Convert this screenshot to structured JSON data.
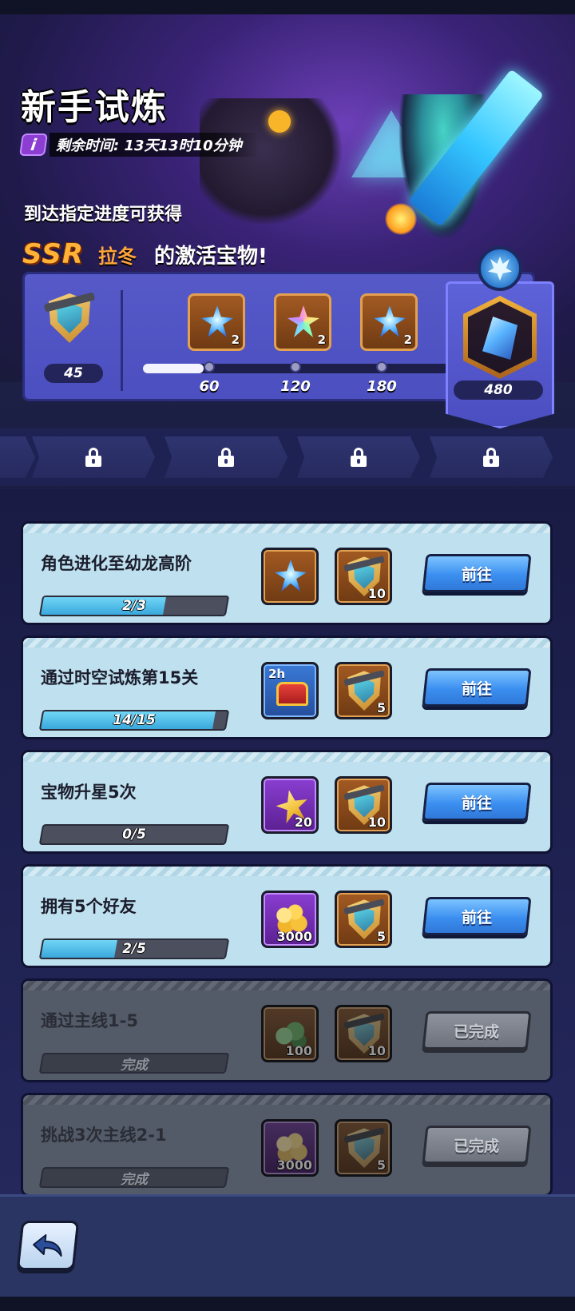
{
  "header": {
    "title": "新手试炼",
    "info_icon": "i",
    "timer_text": "剩余时间: 13天13时10分钟",
    "progress_hint": "到达指定进度可获得",
    "reward_rarity": "SSR",
    "reward_hero": "拉冬",
    "reward_suffix": "的激活宝物!"
  },
  "progress": {
    "current_points": "45",
    "milestones": [
      {
        "points": "60",
        "reward_icon": "blue-star-crystal-icon",
        "count": "2"
      },
      {
        "points": "120",
        "reward_icon": "rainbow-star-crystal-icon",
        "count": "2"
      },
      {
        "points": "180",
        "reward_icon": "blue-star-crystal-icon",
        "count": "2"
      }
    ],
    "final": {
      "points": "480",
      "reward_icon": "frost-gauntlet-icon"
    },
    "track_fill_fraction": 0.18
  },
  "tabs": [
    {
      "locked": true,
      "icon": "lock-icon"
    },
    {
      "locked": true,
      "icon": "lock-icon"
    },
    {
      "locked": true,
      "icon": "lock-icon"
    },
    {
      "locked": true,
      "icon": "lock-icon"
    }
  ],
  "tasks": [
    {
      "title": "角色进化至幼龙高阶",
      "progress_text": "2/3",
      "progress_fraction": 0.6667,
      "rewards": [
        {
          "icon": "blue-star-crystal-icon",
          "count": ""
        },
        {
          "icon": "trial-shield-icon",
          "count": "10"
        }
      ],
      "button": "前往",
      "completed": false
    },
    {
      "title": "通过时空试炼第15关",
      "progress_text": "14/15",
      "progress_fraction": 0.9333,
      "rewards": [
        {
          "icon": "treasure-chest-icon",
          "label": "2h",
          "count": ""
        },
        {
          "icon": "trial-shield-icon",
          "count": "5"
        }
      ],
      "button": "前往",
      "completed": false
    },
    {
      "title": "宝物升星5次",
      "progress_text": "0/5",
      "progress_fraction": 0,
      "rewards": [
        {
          "icon": "gold-star-icon",
          "count": "20"
        },
        {
          "icon": "trial-shield-icon",
          "count": "10"
        }
      ],
      "button": "前往",
      "completed": false
    },
    {
      "title": "拥有5个好友",
      "progress_text": "2/5",
      "progress_fraction": 0.4,
      "rewards": [
        {
          "icon": "gold-coins-icon",
          "count": "3000"
        },
        {
          "icon": "trial-shield-icon",
          "count": "5"
        }
      ],
      "button": "前往",
      "completed": false
    },
    {
      "title": "通过主线1-5",
      "progress_text": "完成",
      "progress_fraction": 0,
      "rewards": [
        {
          "icon": "green-gems-icon",
          "count": "100"
        },
        {
          "icon": "trial-shield-icon",
          "count": "10"
        }
      ],
      "button": "已完成",
      "completed": true
    },
    {
      "title": "挑战3次主线2-1",
      "progress_text": "完成",
      "progress_fraction": 0,
      "rewards": [
        {
          "icon": "gold-coins-icon",
          "count": "3000"
        },
        {
          "icon": "trial-shield-icon",
          "count": "5"
        }
      ],
      "button": "已完成",
      "completed": true
    }
  ],
  "footer": {
    "back_icon": "back-arrow-icon"
  },
  "colors": {
    "accent_orange": "#ffa53a",
    "ssr_gold": "#ffb238",
    "go_button_blue": "#3b8ff0",
    "task_card_active": "#bfe0ee",
    "task_card_done": "#545b68",
    "progress_bar_fill": "#39a8dc"
  }
}
